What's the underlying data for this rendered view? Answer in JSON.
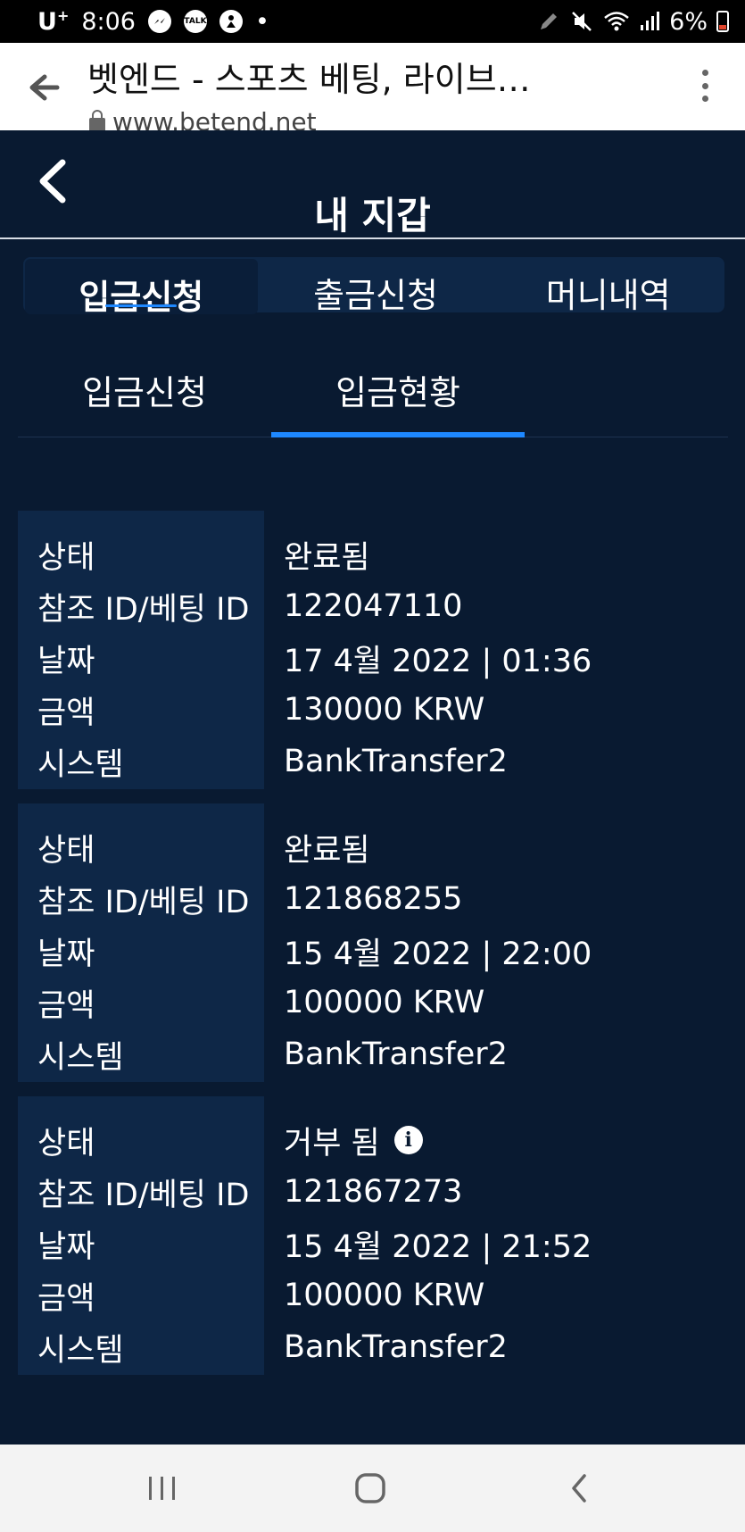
{
  "status_bar": {
    "carrier": "U",
    "carrier_sup": "+",
    "time": "8:06",
    "talk_icon_text": "TALK",
    "dot": "•",
    "battery_text": "6%"
  },
  "browser": {
    "title": "벳엔드 - 스포츠 베팅, 라이브…",
    "url": "www.betend.net"
  },
  "page": {
    "title": "내 지갑"
  },
  "main_tabs": [
    {
      "label": "입금신청",
      "active": true
    },
    {
      "label": "출금신청",
      "active": false
    },
    {
      "label": "머니내역",
      "active": false
    }
  ],
  "sub_tabs": [
    {
      "label": "입금신청",
      "active": false
    },
    {
      "label": "입금현황",
      "active": true
    }
  ],
  "field_labels": {
    "status": "상태",
    "ref_id": "참조 ID/베팅 ID",
    "date": "날짜",
    "amount": "금액",
    "system": "시스템"
  },
  "records": [
    {
      "status": "완료됨",
      "ref_id": "122047110",
      "date": "17 4월 2022 | 01:36",
      "amount": "130000 KRW",
      "system": "BankTransfer2",
      "info_icon": false
    },
    {
      "status": "완료됨",
      "ref_id": "121868255",
      "date": "15 4월 2022 | 22:00",
      "amount": "100000 KRW",
      "system": "BankTransfer2",
      "info_icon": false
    },
    {
      "status": "거부 됨",
      "ref_id": "121867273",
      "date": "15 4월 2022 | 21:52",
      "amount": "100000 KRW",
      "system": "BankTransfer2",
      "info_icon": true
    }
  ],
  "info_icon_glyph": "i",
  "colors": {
    "background": "#091a31",
    "panel": "#0e2747",
    "accent": "#1e88ff",
    "text": "#ffffff"
  }
}
